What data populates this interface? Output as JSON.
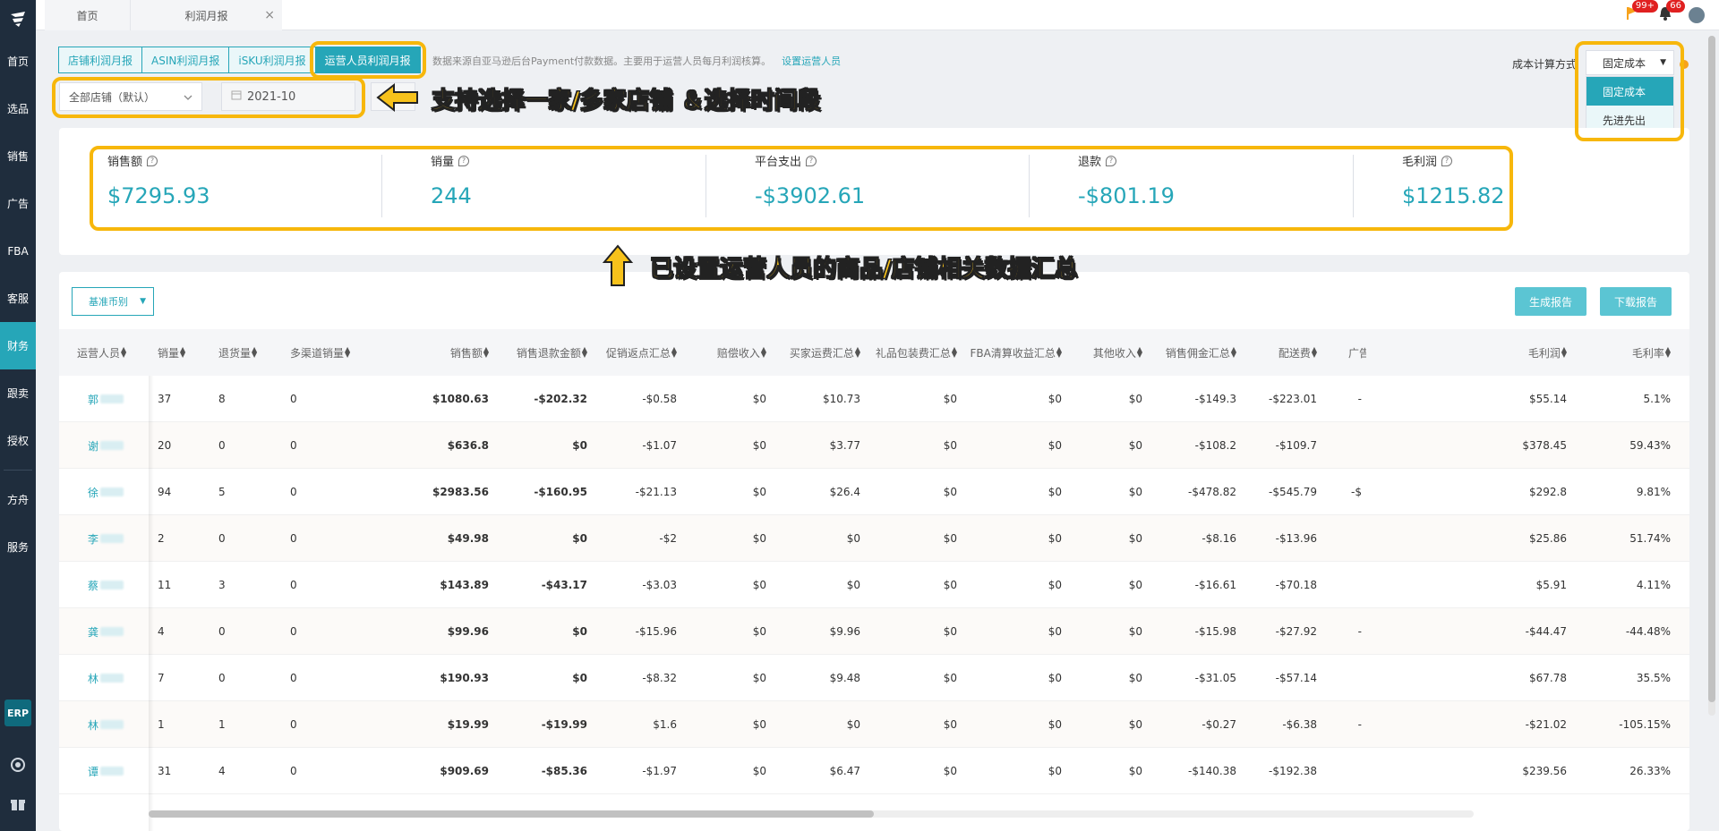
{
  "sidebar": {
    "items": [
      {
        "label": "首页"
      },
      {
        "label": "选品"
      },
      {
        "label": "销售"
      },
      {
        "label": "广告"
      },
      {
        "label": "FBA"
      },
      {
        "label": "客服"
      },
      {
        "label": "财务",
        "active": true
      },
      {
        "label": "跟卖"
      },
      {
        "label": "授权"
      },
      {
        "label": "方舟"
      },
      {
        "label": "服务"
      }
    ],
    "erp_label": "ERP"
  },
  "topbar": {
    "tabs": [
      {
        "label": "首页"
      },
      {
        "label": "利润月报"
      }
    ],
    "close_glyph": "×",
    "flag_badge": "99+",
    "bell_badge": "66"
  },
  "report_tabs": [
    {
      "label": "店铺利润月报"
    },
    {
      "label": "ASIN利润月报"
    },
    {
      "label": "iSKU利润月报"
    },
    {
      "label": "运营人员利润月报",
      "active": true
    }
  ],
  "data_note": {
    "text": "数据来源自亚马逊后台Payment付款数据。主要用于运营人员每月利润核算。",
    "link": "设置运营人员"
  },
  "filters": {
    "store_select": "全部店铺（默认）",
    "date": "2021-10"
  },
  "cost_method": {
    "label": "成本计算方式",
    "selected": "固定成本",
    "options": [
      "固定成本",
      "先进先出"
    ]
  },
  "summary": [
    {
      "label": "销售额",
      "value": "$7295.93"
    },
    {
      "label": "销量",
      "value": "244"
    },
    {
      "label": "平台支出",
      "value": "-$3902.61"
    },
    {
      "label": "退款",
      "value": "-$801.19"
    },
    {
      "label": "毛利润",
      "value": "$1215.82"
    }
  ],
  "table_toolbar": {
    "currency_button": "基准币别",
    "generate_button": "生成报告",
    "download_button": "下载报告"
  },
  "table": {
    "columns": [
      "运营人员",
      "销量",
      "退货量",
      "多渠道销量",
      "销售额",
      "销售退款金额",
      "促销返点汇总",
      "赔偿收入",
      "买家运费汇总",
      "礼品包装费汇总",
      "FBA清算收益汇总",
      "其他收入",
      "销售佣金汇总",
      "配送费",
      "广告",
      "毛利润",
      "毛利率"
    ],
    "rows": [
      [
        "郭",
        "37",
        "8",
        "0",
        "$1080.63",
        "-$202.32",
        "-$0.58",
        "$0",
        "$10.73",
        "$0",
        "$0",
        "$0",
        "-$149.3",
        "-$223.01",
        "-",
        "$55.14",
        "5.1%"
      ],
      [
        "谢",
        "20",
        "0",
        "0",
        "$636.8",
        "$0",
        "-$1.07",
        "$0",
        "$3.77",
        "$0",
        "$0",
        "$0",
        "-$108.2",
        "-$109.7",
        "",
        "$378.45",
        "59.43%"
      ],
      [
        "徐",
        "94",
        "5",
        "0",
        "$2983.56",
        "-$160.95",
        "-$21.13",
        "$0",
        "$26.4",
        "$0",
        "$0",
        "$0",
        "-$478.82",
        "-$545.79",
        "-$",
        "$292.8",
        "9.81%"
      ],
      [
        "李",
        "2",
        "0",
        "0",
        "$49.98",
        "$0",
        "-$2",
        "$0",
        "$0",
        "$0",
        "$0",
        "$0",
        "-$8.16",
        "-$13.96",
        "",
        "$25.86",
        "51.74%"
      ],
      [
        "蔡",
        "11",
        "3",
        "0",
        "$143.89",
        "-$43.17",
        "-$3.03",
        "$0",
        "$0",
        "$0",
        "$0",
        "$0",
        "-$16.61",
        "-$70.18",
        "",
        "$5.91",
        "4.11%"
      ],
      [
        "龚",
        "4",
        "0",
        "0",
        "$99.96",
        "$0",
        "-$15.96",
        "$0",
        "$9.96",
        "$0",
        "$0",
        "$0",
        "-$15.98",
        "-$27.92",
        "-",
        "-$44.47",
        "-44.48%"
      ],
      [
        "林",
        "7",
        "0",
        "0",
        "$190.93",
        "$0",
        "-$8.32",
        "$0",
        "$9.48",
        "$0",
        "$0",
        "$0",
        "-$31.05",
        "-$57.14",
        "",
        "$67.78",
        "35.5%"
      ],
      [
        "林",
        "1",
        "1",
        "0",
        "$19.99",
        "-$19.99",
        "$1.6",
        "$0",
        "$0",
        "$0",
        "$0",
        "$0",
        "-$0.27",
        "-$6.38",
        "-",
        "-$21.02",
        "-105.15%"
      ],
      [
        "谭",
        "31",
        "4",
        "0",
        "$909.69",
        "-$85.36",
        "-$1.97",
        "$0",
        "$6.47",
        "$0",
        "$0",
        "$0",
        "-$140.38",
        "-$192.38",
        "",
        "$239.56",
        "26.33%"
      ]
    ]
  },
  "annotations": {
    "filter_hint": "支持选择一家/多家店铺 ＆选择时间段",
    "summary_hint": "已设置运营人员的商品/店铺相关数据汇总"
  },
  "colors": {
    "accent": "#26a6b8",
    "sidebar": "#1f2d3d",
    "highlight": "#f7b70b"
  }
}
